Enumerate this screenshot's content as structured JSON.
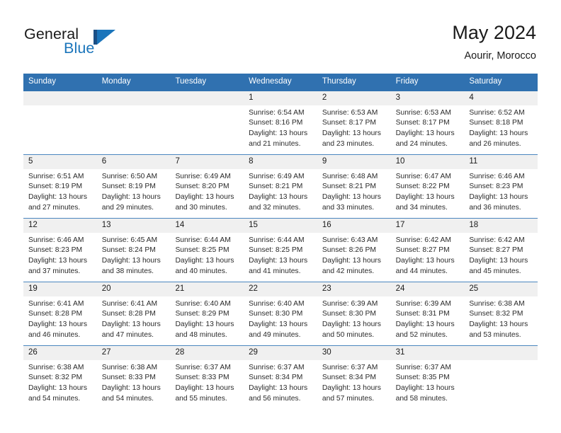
{
  "brand": {
    "name_part1": "General",
    "name_part2": "Blue",
    "logo_bar_color": "#1a4f86",
    "logo_triangle_color": "#1b75bb"
  },
  "header": {
    "title": "May 2024",
    "subtitle": "Aourir, Morocco",
    "accent_color": "#3071b0",
    "day_band_color": "#f0f0f0"
  },
  "weekdays": [
    "Sunday",
    "Monday",
    "Tuesday",
    "Wednesday",
    "Thursday",
    "Friday",
    "Saturday"
  ],
  "weeks": [
    [
      {
        "day": "",
        "sunrise": "",
        "sunset": "",
        "daylight_line1": "",
        "daylight_line2": ""
      },
      {
        "day": "",
        "sunrise": "",
        "sunset": "",
        "daylight_line1": "",
        "daylight_line2": ""
      },
      {
        "day": "",
        "sunrise": "",
        "sunset": "",
        "daylight_line1": "",
        "daylight_line2": ""
      },
      {
        "day": "1",
        "sunrise": "Sunrise: 6:54 AM",
        "sunset": "Sunset: 8:16 PM",
        "daylight_line1": "Daylight: 13 hours",
        "daylight_line2": "and 21 minutes."
      },
      {
        "day": "2",
        "sunrise": "Sunrise: 6:53 AM",
        "sunset": "Sunset: 8:17 PM",
        "daylight_line1": "Daylight: 13 hours",
        "daylight_line2": "and 23 minutes."
      },
      {
        "day": "3",
        "sunrise": "Sunrise: 6:53 AM",
        "sunset": "Sunset: 8:17 PM",
        "daylight_line1": "Daylight: 13 hours",
        "daylight_line2": "and 24 minutes."
      },
      {
        "day": "4",
        "sunrise": "Sunrise: 6:52 AM",
        "sunset": "Sunset: 8:18 PM",
        "daylight_line1": "Daylight: 13 hours",
        "daylight_line2": "and 26 minutes."
      }
    ],
    [
      {
        "day": "5",
        "sunrise": "Sunrise: 6:51 AM",
        "sunset": "Sunset: 8:19 PM",
        "daylight_line1": "Daylight: 13 hours",
        "daylight_line2": "and 27 minutes."
      },
      {
        "day": "6",
        "sunrise": "Sunrise: 6:50 AM",
        "sunset": "Sunset: 8:19 PM",
        "daylight_line1": "Daylight: 13 hours",
        "daylight_line2": "and 29 minutes."
      },
      {
        "day": "7",
        "sunrise": "Sunrise: 6:49 AM",
        "sunset": "Sunset: 8:20 PM",
        "daylight_line1": "Daylight: 13 hours",
        "daylight_line2": "and 30 minutes."
      },
      {
        "day": "8",
        "sunrise": "Sunrise: 6:49 AM",
        "sunset": "Sunset: 8:21 PM",
        "daylight_line1": "Daylight: 13 hours",
        "daylight_line2": "and 32 minutes."
      },
      {
        "day": "9",
        "sunrise": "Sunrise: 6:48 AM",
        "sunset": "Sunset: 8:21 PM",
        "daylight_line1": "Daylight: 13 hours",
        "daylight_line2": "and 33 minutes."
      },
      {
        "day": "10",
        "sunrise": "Sunrise: 6:47 AM",
        "sunset": "Sunset: 8:22 PM",
        "daylight_line1": "Daylight: 13 hours",
        "daylight_line2": "and 34 minutes."
      },
      {
        "day": "11",
        "sunrise": "Sunrise: 6:46 AM",
        "sunset": "Sunset: 8:23 PM",
        "daylight_line1": "Daylight: 13 hours",
        "daylight_line2": "and 36 minutes."
      }
    ],
    [
      {
        "day": "12",
        "sunrise": "Sunrise: 6:46 AM",
        "sunset": "Sunset: 8:23 PM",
        "daylight_line1": "Daylight: 13 hours",
        "daylight_line2": "and 37 minutes."
      },
      {
        "day": "13",
        "sunrise": "Sunrise: 6:45 AM",
        "sunset": "Sunset: 8:24 PM",
        "daylight_line1": "Daylight: 13 hours",
        "daylight_line2": "and 38 minutes."
      },
      {
        "day": "14",
        "sunrise": "Sunrise: 6:44 AM",
        "sunset": "Sunset: 8:25 PM",
        "daylight_line1": "Daylight: 13 hours",
        "daylight_line2": "and 40 minutes."
      },
      {
        "day": "15",
        "sunrise": "Sunrise: 6:44 AM",
        "sunset": "Sunset: 8:25 PM",
        "daylight_line1": "Daylight: 13 hours",
        "daylight_line2": "and 41 minutes."
      },
      {
        "day": "16",
        "sunrise": "Sunrise: 6:43 AM",
        "sunset": "Sunset: 8:26 PM",
        "daylight_line1": "Daylight: 13 hours",
        "daylight_line2": "and 42 minutes."
      },
      {
        "day": "17",
        "sunrise": "Sunrise: 6:42 AM",
        "sunset": "Sunset: 8:27 PM",
        "daylight_line1": "Daylight: 13 hours",
        "daylight_line2": "and 44 minutes."
      },
      {
        "day": "18",
        "sunrise": "Sunrise: 6:42 AM",
        "sunset": "Sunset: 8:27 PM",
        "daylight_line1": "Daylight: 13 hours",
        "daylight_line2": "and 45 minutes."
      }
    ],
    [
      {
        "day": "19",
        "sunrise": "Sunrise: 6:41 AM",
        "sunset": "Sunset: 8:28 PM",
        "daylight_line1": "Daylight: 13 hours",
        "daylight_line2": "and 46 minutes."
      },
      {
        "day": "20",
        "sunrise": "Sunrise: 6:41 AM",
        "sunset": "Sunset: 8:28 PM",
        "daylight_line1": "Daylight: 13 hours",
        "daylight_line2": "and 47 minutes."
      },
      {
        "day": "21",
        "sunrise": "Sunrise: 6:40 AM",
        "sunset": "Sunset: 8:29 PM",
        "daylight_line1": "Daylight: 13 hours",
        "daylight_line2": "and 48 minutes."
      },
      {
        "day": "22",
        "sunrise": "Sunrise: 6:40 AM",
        "sunset": "Sunset: 8:30 PM",
        "daylight_line1": "Daylight: 13 hours",
        "daylight_line2": "and 49 minutes."
      },
      {
        "day": "23",
        "sunrise": "Sunrise: 6:39 AM",
        "sunset": "Sunset: 8:30 PM",
        "daylight_line1": "Daylight: 13 hours",
        "daylight_line2": "and 50 minutes."
      },
      {
        "day": "24",
        "sunrise": "Sunrise: 6:39 AM",
        "sunset": "Sunset: 8:31 PM",
        "daylight_line1": "Daylight: 13 hours",
        "daylight_line2": "and 52 minutes."
      },
      {
        "day": "25",
        "sunrise": "Sunrise: 6:38 AM",
        "sunset": "Sunset: 8:32 PM",
        "daylight_line1": "Daylight: 13 hours",
        "daylight_line2": "and 53 minutes."
      }
    ],
    [
      {
        "day": "26",
        "sunrise": "Sunrise: 6:38 AM",
        "sunset": "Sunset: 8:32 PM",
        "daylight_line1": "Daylight: 13 hours",
        "daylight_line2": "and 54 minutes."
      },
      {
        "day": "27",
        "sunrise": "Sunrise: 6:38 AM",
        "sunset": "Sunset: 8:33 PM",
        "daylight_line1": "Daylight: 13 hours",
        "daylight_line2": "and 54 minutes."
      },
      {
        "day": "28",
        "sunrise": "Sunrise: 6:37 AM",
        "sunset": "Sunset: 8:33 PM",
        "daylight_line1": "Daylight: 13 hours",
        "daylight_line2": "and 55 minutes."
      },
      {
        "day": "29",
        "sunrise": "Sunrise: 6:37 AM",
        "sunset": "Sunset: 8:34 PM",
        "daylight_line1": "Daylight: 13 hours",
        "daylight_line2": "and 56 minutes."
      },
      {
        "day": "30",
        "sunrise": "Sunrise: 6:37 AM",
        "sunset": "Sunset: 8:34 PM",
        "daylight_line1": "Daylight: 13 hours",
        "daylight_line2": "and 57 minutes."
      },
      {
        "day": "31",
        "sunrise": "Sunrise: 6:37 AM",
        "sunset": "Sunset: 8:35 PM",
        "daylight_line1": "Daylight: 13 hours",
        "daylight_line2": "and 58 minutes."
      },
      {
        "day": "",
        "sunrise": "",
        "sunset": "",
        "daylight_line1": "",
        "daylight_line2": ""
      }
    ]
  ]
}
